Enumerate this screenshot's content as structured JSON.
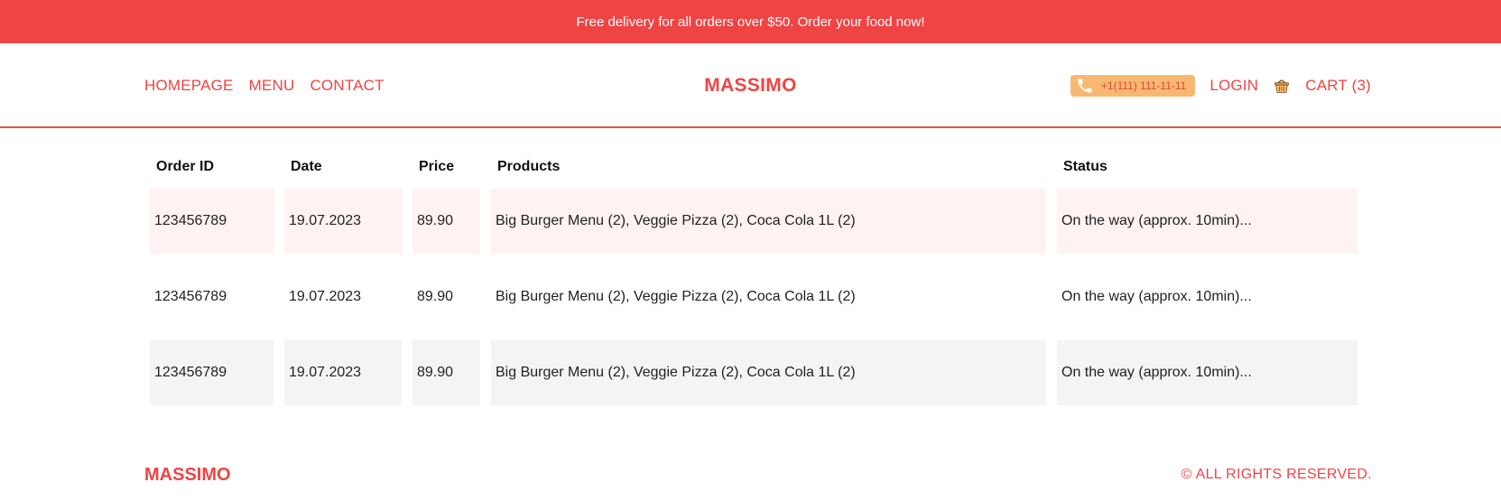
{
  "banner": {
    "text": "Free delivery for all orders over $50. Order your food now!"
  },
  "nav": {
    "links": [
      "HOMEPAGE",
      "MENU",
      "CONTACT"
    ],
    "logo": "MASSIMO",
    "phone": "+1(111) 111-11-11",
    "login": "LOGIN",
    "cart": "CART (3)",
    "phone_icon": "phone-icon",
    "basket_icon": "basket-icon"
  },
  "orders": {
    "headers": [
      "Order ID",
      "Date",
      "Price",
      "Products",
      "Status"
    ],
    "rows": [
      {
        "id": "123456789",
        "date": "19.07.2023",
        "price": "89.90",
        "products": "Big Burger Menu (2), Veggie Pizza (2), Coca Cola 1L (2)",
        "status": "On the way (approx. 10min)..."
      },
      {
        "id": "123456789",
        "date": "19.07.2023",
        "price": "89.90",
        "products": "Big Burger Menu (2), Veggie Pizza (2), Coca Cola 1L (2)",
        "status": "On the way (approx. 10min)..."
      },
      {
        "id": "123456789",
        "date": "19.07.2023",
        "price": "89.90",
        "products": "Big Burger Menu (2), Veggie Pizza (2), Coca Cola 1L (2)",
        "status": "On the way (approx. 10min)..."
      }
    ]
  },
  "footer": {
    "logo": "MASSIMO",
    "copyright": "© ALL RIGHTS RESERVED."
  },
  "colors": {
    "accent": "#ef4444",
    "phone_pill": "#f9b872",
    "row_pink": "#fef2f2",
    "row_gray": "#f3f4f6"
  }
}
